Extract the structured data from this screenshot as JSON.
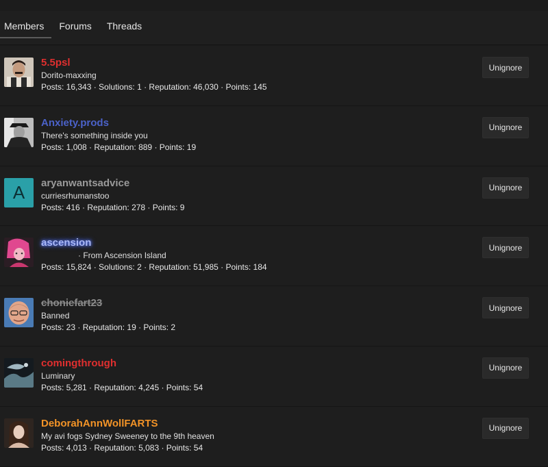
{
  "tabs": [
    {
      "label": "Members"
    },
    {
      "label": "Forums"
    },
    {
      "label": "Threads"
    }
  ],
  "button_label": "Unignore",
  "members": [
    {
      "username": "5.5psl",
      "tagline": "Dorito-maxxing",
      "stats": "Posts: 16,343 · Solutions: 1 · Reputation: 46,030 · Points: 145"
    },
    {
      "username": "Anxiety.prods",
      "tagline": "There's something inside you",
      "stats": "Posts: 1,008 · Reputation: 889 · Points: 19"
    },
    {
      "username": "aryanwantsadvice",
      "avatar_letter": "A",
      "tagline": "curriesrhumanstoo",
      "stats": "Posts: 416 · Reputation: 278 · Points: 9"
    },
    {
      "username": "ascension",
      "tagline": "· From Ascension Island",
      "stats": "Posts: 15,824 · Solutions: 2 · Reputation: 51,985 · Points: 184"
    },
    {
      "username": "choniefart23",
      "tagline": "Banned",
      "stats": "Posts: 23 · Reputation: 19 · Points: 2"
    },
    {
      "username": "comingthrough",
      "tagline": "Luminary",
      "stats": "Posts: 5,281 · Reputation: 4,245 · Points: 54"
    },
    {
      "username": "DeborahAnnWollFARTS",
      "tagline": "My avi fogs Sydney Sweeney to the 9th heaven",
      "stats": "Posts: 4,013 · Reputation: 5,083 · Points: 54"
    }
  ]
}
